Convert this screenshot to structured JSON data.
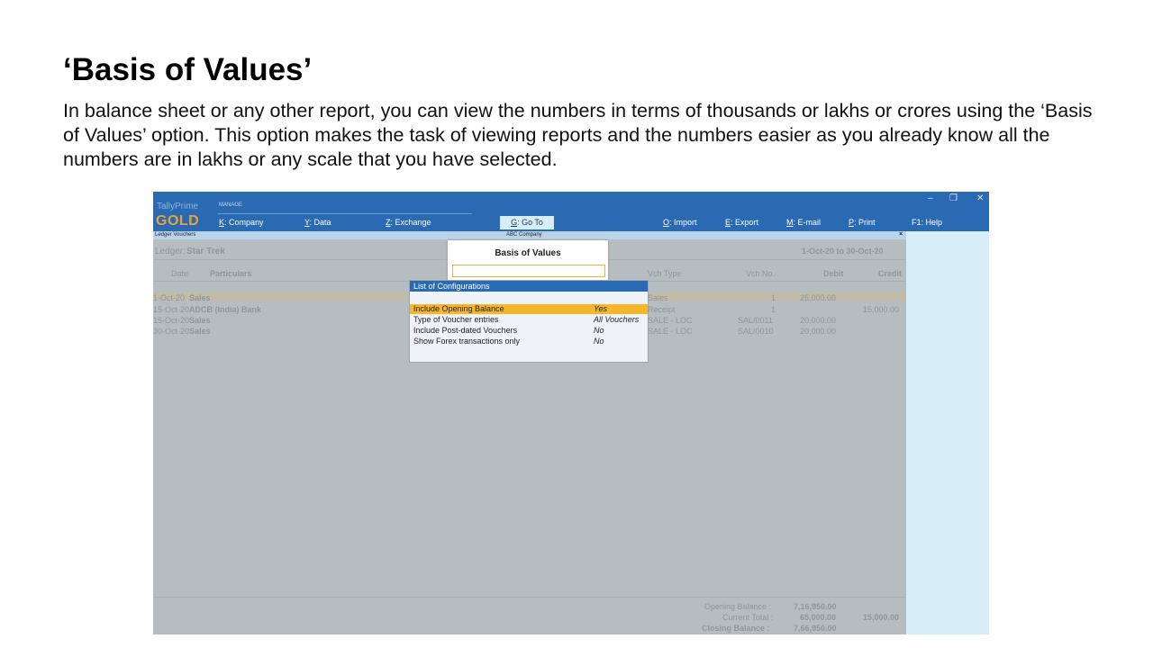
{
  "slide": {
    "title": "‘Basis of Values’",
    "body": "In balance sheet or any other report, you can view the numbers in terms of thousands or lakhs or crores using the ‘Basis of Values’ option. This option makes the task of viewing reports and the numbers easier as you already know all the numbers are in lakhs or any scale that you have selected."
  },
  "app": {
    "brand_top": "TallyPrime",
    "brand_edition": "GOLD",
    "manage_label": "MANAGE",
    "menu": [
      {
        "key": "K",
        "label": ": Company"
      },
      {
        "key": "Y",
        "label": ": Data"
      },
      {
        "key": "Z",
        "label": ": Exchange"
      },
      {
        "key": "G",
        "label": ": Go To"
      },
      {
        "key": "O",
        "label": ": Import"
      },
      {
        "key": "E",
        "label": ": Export"
      },
      {
        "key": "M",
        "label": ": E-mail"
      },
      {
        "key": "P",
        "label": ": Print"
      },
      {
        "key": "F1",
        "label": ": Help"
      }
    ],
    "window_controls": {
      "minimize": "–",
      "restore": "❐",
      "close": "✕"
    },
    "colors": {
      "topbar": "#2a6ab3",
      "brand": "#e8a23a",
      "selection": "#f6b62b"
    }
  },
  "status": {
    "report_name": "Ledger Vouchers",
    "company": "ABC Company",
    "close": "×"
  },
  "report": {
    "ledger_label": "Ledger:",
    "ledger_name": "Star Trek",
    "period": "1-Oct-20 to 30-Oct-20",
    "columns": [
      "Date",
      "Particulars",
      "Vch Type",
      "Vch No.",
      "Debit",
      "Credit"
    ],
    "rows": [
      {
        "date": "1-Oct-20",
        "particulars": "Sales",
        "vch_type": "Sales",
        "vch_no": "1",
        "debit": "25,000.00",
        "credit": ""
      },
      {
        "date": "15-Oct-20",
        "particulars": "ADCB (India) Bank",
        "vch_type": "Receipt",
        "vch_no": "1",
        "debit": "",
        "credit": "15,000.00"
      },
      {
        "date": "15-Oct-20",
        "particulars": "Sales",
        "vch_type": "SALE - LOC",
        "vch_no": "SAL/0011",
        "debit": "20,000.00",
        "credit": ""
      },
      {
        "date": "30-Oct-20",
        "particulars": "Sales",
        "vch_type": "SALE - LOC",
        "vch_no": "SAL/0010",
        "debit": "20,000.00",
        "credit": ""
      }
    ],
    "totals": {
      "opening_label": "Opening Balance :",
      "opening_debit": "7,16,950.00",
      "current_label": "Current Total :",
      "current_debit": "65,000.00",
      "current_credit": "15,000.00",
      "closing_label": "Closing Balance :",
      "closing_debit": "7,66,950.00"
    }
  },
  "basis_popup": {
    "title": "Basis of Values",
    "input_value": ""
  },
  "config_popup": {
    "title": "List of Configurations",
    "items": [
      {
        "label": "Include Opening Balance",
        "value": "Yes"
      },
      {
        "label": "Type of Voucher entries",
        "value": "All Vouchers"
      },
      {
        "label": "Include Post-dated Vouchers",
        "value": "No"
      },
      {
        "label": "Show Forex transactions only",
        "value": "No"
      }
    ]
  }
}
